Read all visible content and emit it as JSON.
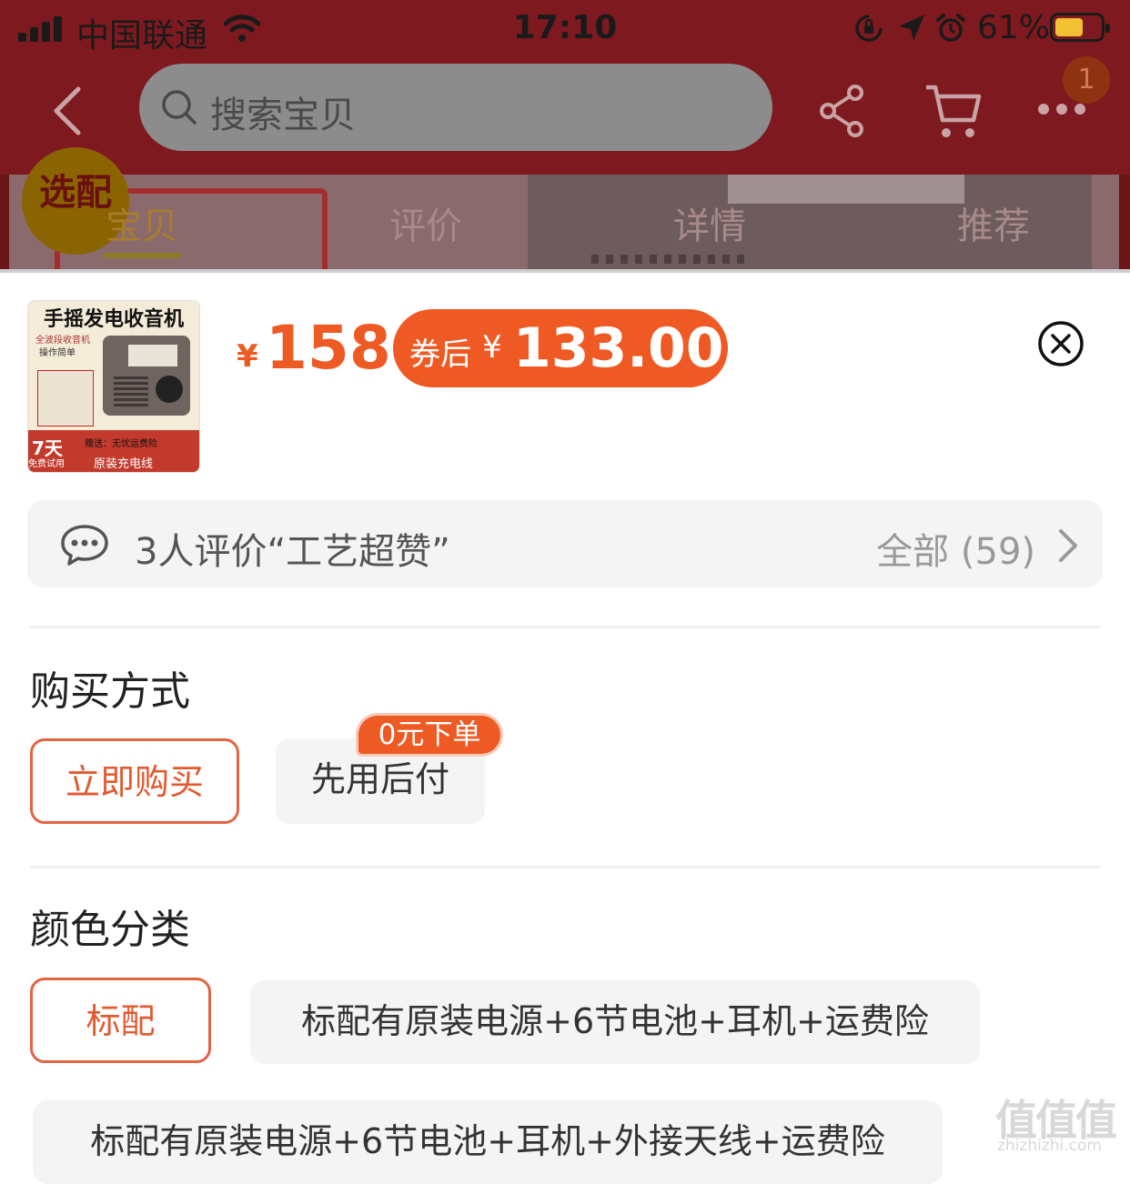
{
  "status_bar": {
    "carrier": "中国联通",
    "time": "17:10",
    "battery_percent": "61%"
  },
  "nav": {
    "search_placeholder": "搜索宝贝",
    "cart_badge": "1"
  },
  "hero": {
    "badge": "选配"
  },
  "tabs": [
    {
      "label": "宝贝",
      "active": true
    },
    {
      "label": "评价",
      "active": false
    },
    {
      "label": "详情",
      "active": false
    },
    {
      "label": "推荐",
      "active": false
    }
  ],
  "product": {
    "thumb_title": "手摇发电收音机",
    "thumb_subtitle": "全波段收音机",
    "thumb_subtitle2": "操作简单",
    "thumb_days": "7天",
    "thumb_trial": "免费试用",
    "thumb_shipping": "赠送：无忧运费险",
    "thumb_gift": "原装充电线",
    "price_symbol": "¥",
    "price": "158",
    "coupon_label": "券后",
    "coupon_symbol": "¥",
    "coupon_price": "133.00"
  },
  "reviews": {
    "summary": "3人评价“工艺超赞”",
    "all_label": "全部 (59)"
  },
  "purchase_method": {
    "title": "购买方式",
    "options": [
      {
        "label": "立即购买",
        "selected": true
      },
      {
        "label": "先用后付",
        "selected": false,
        "tag": "0元下单"
      }
    ]
  },
  "color_category": {
    "title": "颜色分类",
    "options": [
      {
        "label": "标配",
        "selected": true
      },
      {
        "label": "标配有原装电源+6节电池+耳机+运费险",
        "selected": false
      },
      {
        "label": "标配有原装电源+6节电池+耳机+外接天线+运费险",
        "selected": false
      }
    ]
  },
  "watermark": {
    "big": "值值值",
    "small": "zhizhizhi.com"
  },
  "colors": {
    "accent": "#ee5a24",
    "selected_border": "#e26443",
    "option_bg": "#f4f4f4",
    "overlay_red": "#7e1a1f"
  }
}
